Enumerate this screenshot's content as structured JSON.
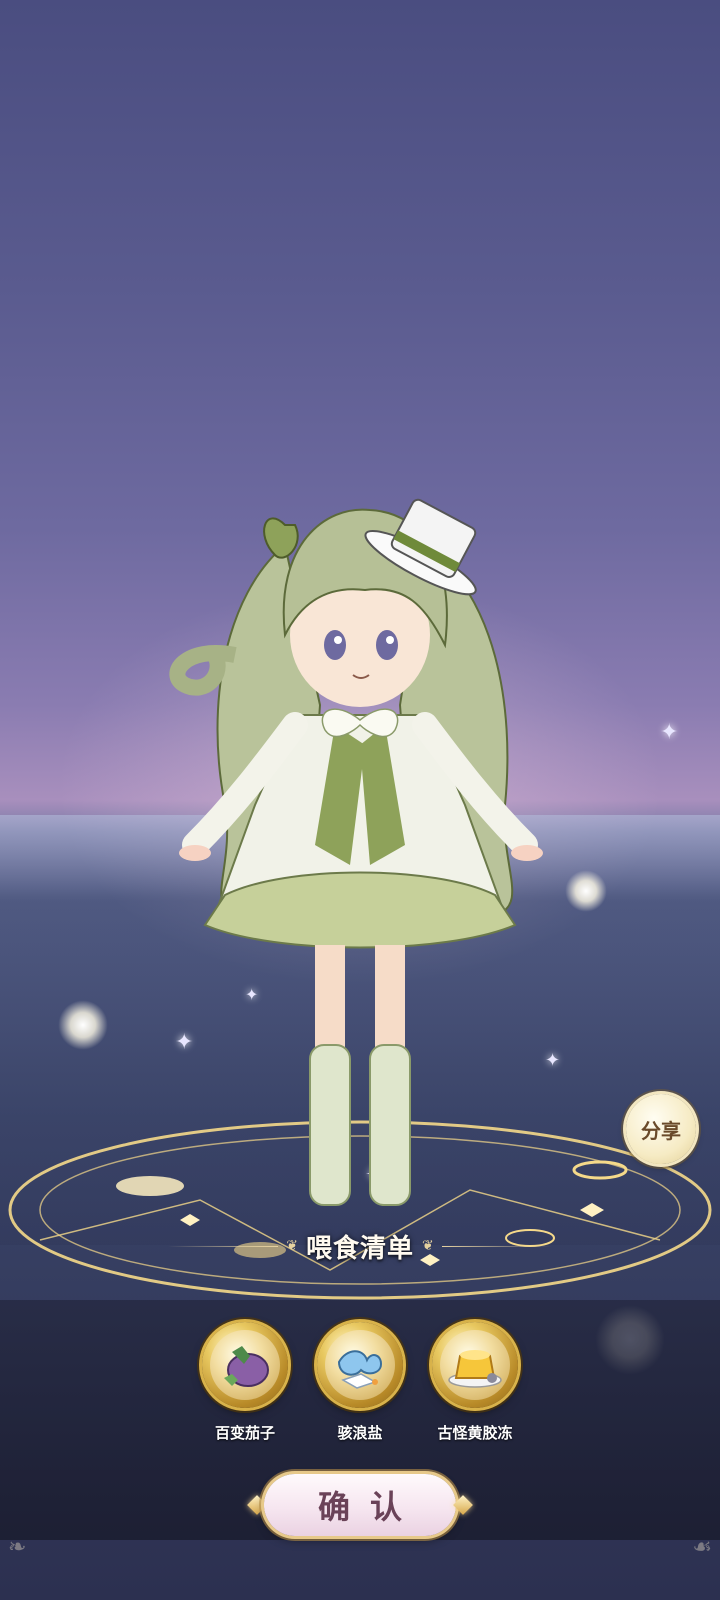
{
  "feed_list": {
    "title": "喂食清单",
    "items": [
      {
        "label": "百变茄子",
        "icon": "eggplant-icon"
      },
      {
        "label": "骇浪盐",
        "icon": "wave-salt-icon"
      },
      {
        "label": "古怪黄胶冻",
        "icon": "yellow-jelly-icon"
      }
    ]
  },
  "share_label": "分享",
  "confirm_label": "确认",
  "colors": {
    "sky_top": "#4a4d80",
    "horizon_glow": "#a88fbd",
    "orb_gold": "#d8b24a",
    "button_text": "#6a4258"
  }
}
